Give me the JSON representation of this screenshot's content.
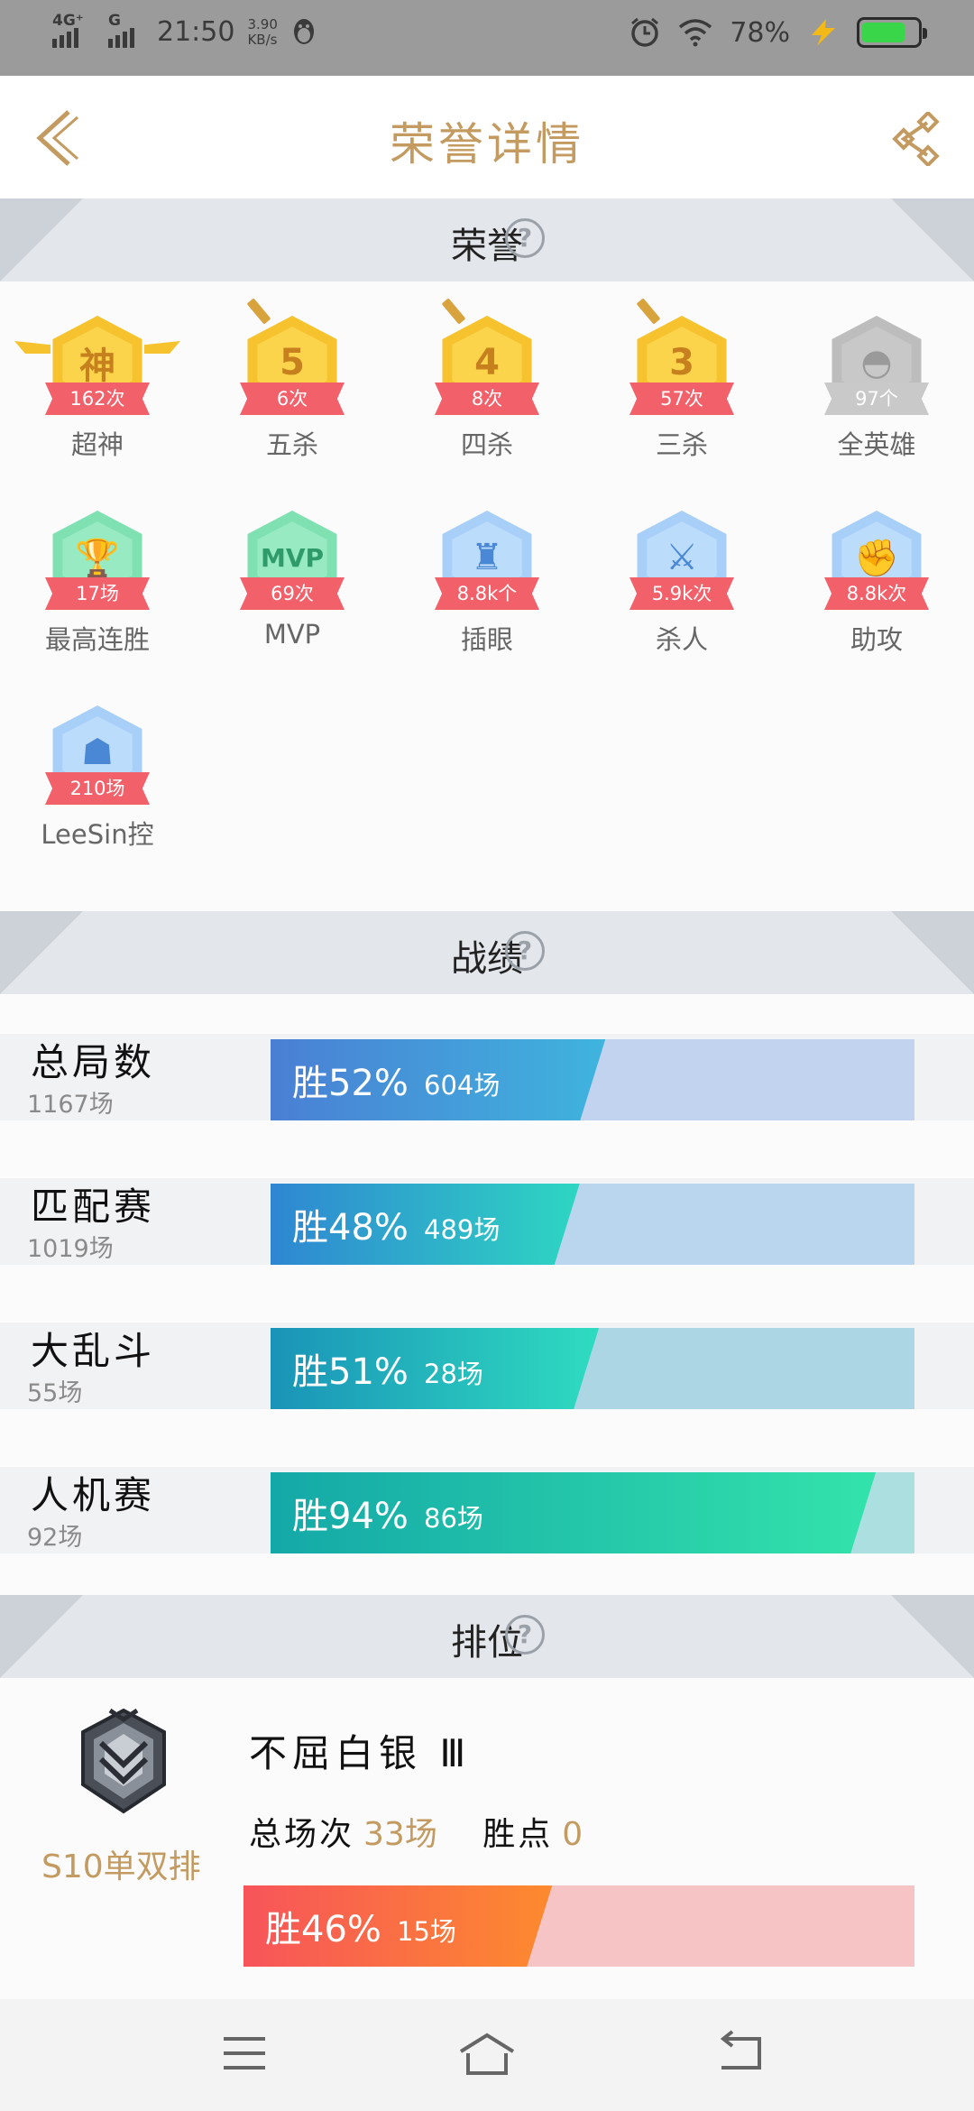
{
  "status_bar": {
    "network1": "4G⁺",
    "network2": "G",
    "time": "21:50",
    "speed_value": "3.90",
    "speed_unit": "KB/s",
    "battery_text": "78%",
    "battery_level": 0.78,
    "battery_color": "#3ad64a"
  },
  "header": {
    "title": "荣誉详情"
  },
  "sections": {
    "honor": "荣誉",
    "record": "战绩",
    "rank": "排位",
    "help": "?"
  },
  "honors": [
    {
      "name": "超神",
      "count": "162次",
      "glyph": "神",
      "style": "gold",
      "icon": "wings-emblem-icon"
    },
    {
      "name": "五杀",
      "count": "6次",
      "glyph": "5",
      "style": "gold",
      "icon": "sword-badge-icon"
    },
    {
      "name": "四杀",
      "count": "8次",
      "glyph": "4",
      "style": "gold",
      "icon": "sword-badge-icon"
    },
    {
      "name": "三杀",
      "count": "57次",
      "glyph": "3",
      "style": "gold",
      "icon": "sword-badge-icon"
    },
    {
      "name": "全英雄",
      "count": "97个",
      "glyph": "◓",
      "style": "grey",
      "icon": "helmet-icon"
    },
    {
      "name": "最高连胜",
      "count": "17场",
      "glyph": "🏆",
      "style": "green",
      "icon": "trophy-icon"
    },
    {
      "name": "MVP",
      "count": "69次",
      "glyph": "MVP",
      "style": "green",
      "icon": "mvp-crown-icon"
    },
    {
      "name": "插眼",
      "count": "8.8k个",
      "glyph": "♜",
      "style": "blue",
      "icon": "ward-icon"
    },
    {
      "name": "杀人",
      "count": "5.9k次",
      "glyph": "⚔",
      "style": "blue",
      "icon": "kill-icon"
    },
    {
      "name": "助攻",
      "count": "8.8k次",
      "glyph": "✊",
      "style": "blue",
      "icon": "assist-icon"
    },
    {
      "name": "LeeSin控",
      "count": "210场",
      "glyph": "☗",
      "style": "blue",
      "icon": "champion-portrait-icon"
    }
  ],
  "records": [
    {
      "name": "总局数",
      "total": "1167场",
      "win_label": "胜52%",
      "games": "604场",
      "win_rate": 0.52,
      "fill": "linear-gradient(90deg,#4a7fd4,#3fb4de)",
      "bg": "#c1d3ef"
    },
    {
      "name": "匹配赛",
      "total": "1019场",
      "win_label": "胜48%",
      "games": "489场",
      "win_rate": 0.48,
      "fill": "linear-gradient(90deg,#2f86d2,#2ed6c2)",
      "bg": "#b9d6ee"
    },
    {
      "name": "大乱斗",
      "total": "55场",
      "win_label": "胜51%",
      "games": "28场",
      "win_rate": 0.51,
      "fill": "linear-gradient(90deg,#1a93b8,#2fdcc0)",
      "bg": "#acd6e4"
    },
    {
      "name": "人机赛",
      "total": "92场",
      "win_label": "胜94%",
      "games": "86场",
      "win_rate": 0.94,
      "fill": "linear-gradient(90deg,#14a8a8,#33e3ab)",
      "bg": "#acdfe0"
    }
  ],
  "rank": {
    "mode": "S10单双排",
    "tier": "不屈白银 Ⅲ",
    "total_label": "总场次",
    "total_value": "33场",
    "points_label": "胜点",
    "points_value": "0",
    "win_label": "胜46%",
    "games": "15场",
    "win_rate": 0.46
  }
}
